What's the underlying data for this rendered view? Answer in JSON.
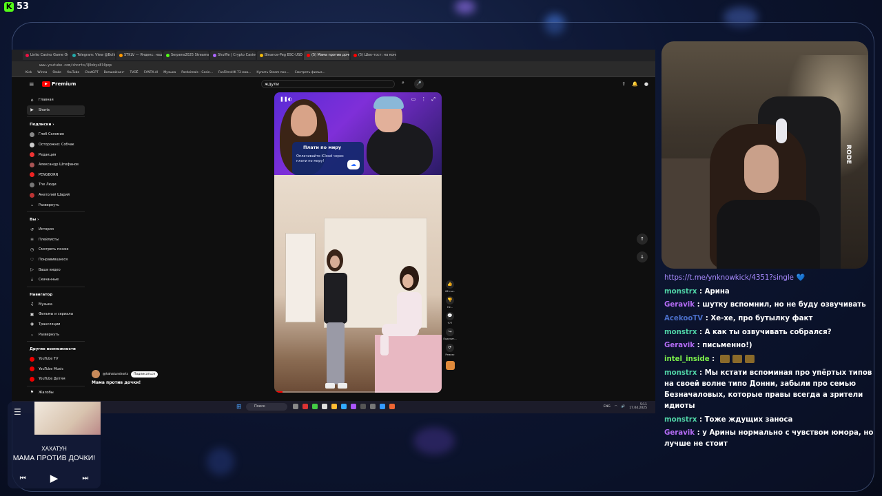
{
  "kick": {
    "viewer_count": "53"
  },
  "browser": {
    "tabs": [
      {
        "label": "Linko Casino Game Onlin",
        "color": "#e14"
      },
      {
        "label": "Telegram: View @Bollon",
        "color": "#2aa"
      },
      {
        "label": "STKLV — Яндекс: нашл",
        "color": "#f90"
      },
      {
        "label": "Serpens2025 Streams - kl",
        "color": "#53fc18"
      },
      {
        "label": "Shuffle | Crypto Casino S",
        "color": "#a6f"
      },
      {
        "label": "Binance-Peg BSC-USD (",
        "color": "#f0b90b"
      },
      {
        "label": "(5) Мама против доче",
        "color": "#f00"
      },
      {
        "label": "(5) Шок-тост: на концерт",
        "color": "#f00"
      }
    ],
    "url": "www.youtube.com/shorts/QOnbys8l0pqs",
    "bookmarks": [
      "Kick",
      "Winna",
      "Stake",
      "YouTube",
      "ChatGPT",
      "Вопшейнинг",
      "TVOЁ",
      "SYNTX.AI",
      "Музыка",
      "Pardaimals - Casin...",
      "FanFilmsHK 73 мов...",
      "Купить Steam пон...",
      "Смотреть фильм..."
    ]
  },
  "youtube": {
    "logo_text": "Premium",
    "search_value": "ждули",
    "sidebar": {
      "main": [
        {
          "label": "Главная",
          "icon": "home-icon",
          "glyph": "⌂"
        },
        {
          "label": "Shorts",
          "icon": "shorts-icon",
          "glyph": "▶",
          "active": true
        }
      ],
      "subs_heading": "Подписки  ›",
      "subs": [
        {
          "label": "Глеб Соломин",
          "color": "#888"
        },
        {
          "label": "Осторожно: Собчак",
          "color": "#ccc"
        },
        {
          "label": "Редакция",
          "color": "#e33"
        },
        {
          "label": "Александр Штефанов",
          "color": "#a55"
        },
        {
          "label": "PENGBORN",
          "color": "#e22"
        },
        {
          "label": "The Люди",
          "color": "#777"
        },
        {
          "label": "Анатолий Шарий",
          "color": "#b33"
        },
        {
          "label": "Развернуть",
          "color": "",
          "glyph": "⌄"
        }
      ],
      "you_heading": "Вы  ›",
      "you": [
        {
          "label": "История",
          "glyph": "↺"
        },
        {
          "label": "Плейлисты",
          "glyph": "≡"
        },
        {
          "label": "Смотреть позже",
          "glyph": "◷"
        },
        {
          "label": "Понравившиеся",
          "glyph": "♡"
        },
        {
          "label": "Ваши видео",
          "glyph": "▷"
        },
        {
          "label": "Скачанные",
          "glyph": "⤓"
        }
      ],
      "nav_heading": "Навигатор",
      "nav": [
        {
          "label": "Музыка",
          "glyph": "♫"
        },
        {
          "label": "Фильмы и сериалы",
          "glyph": "▣"
        },
        {
          "label": "Трансляции",
          "glyph": "◉"
        },
        {
          "label": "Развернуть",
          "glyph": "⌄"
        }
      ],
      "other_heading": "Другие возможности",
      "other": [
        {
          "label": "YouTube TV",
          "color": "#e00"
        },
        {
          "label": "YouTube Music",
          "color": "#e00"
        },
        {
          "label": "YouTube Детям",
          "color": "#e00"
        }
      ],
      "footer": "Жалобы"
    },
    "ad": {
      "title": "Плати по миру",
      "text": "Оплачивайте iCloud через плати по миру!"
    },
    "actions": [
      {
        "glyph": "👍",
        "label": "86 тыс."
      },
      {
        "glyph": "👎",
        "label": "Не..."
      },
      {
        "glyph": "💬",
        "label": "977"
      },
      {
        "glyph": "↪",
        "label": "Поделит..."
      },
      {
        "glyph": "⟳",
        "label": "Ремикс"
      }
    ],
    "channel_name": "@hahatunshorts",
    "subscribe_label": "Подписаться",
    "short_title": "Мама против дочки!",
    "progress": 0.05
  },
  "taskbar": {
    "search_placeholder": "Поиск",
    "lang": "ENG",
    "time": "5:11",
    "date": "17.04.2025"
  },
  "chat": {
    "link": "https://t.me/ynknowkick/4351?single",
    "messages": [
      {
        "user": "monstrx",
        "color": "#4fd1a5",
        "text": "Арина"
      },
      {
        "user": "Geravik",
        "color": "#b46cf5",
        "text": "шутку вспомнил, но не буду озвучивать"
      },
      {
        "user": "AcekooTV",
        "color": "#4a6ec8",
        "text": "Хе-хе, про бутылку факт"
      },
      {
        "user": "monstrx",
        "color": "#4fd1a5",
        "text": "А как ты озвучивать собрался?"
      },
      {
        "user": "Geravik",
        "color": "#b46cf5",
        "text": "письменно!)"
      },
      {
        "user": "intel_inside",
        "color": "#7cf04a",
        "text": "",
        "emotes": 3
      },
      {
        "user": "monstrx",
        "color": "#4fd1a5",
        "text": "Мы кстати вспоминая про упёртых типов на своей волне типо Донни, забыли про семью Безначаловых, которые правы всегда а зрители идиоты"
      },
      {
        "user": "monstrx",
        "color": "#4fd1a5",
        "text": "Тоже ждущих заноса"
      },
      {
        "user": "Geravik",
        "color": "#b46cf5",
        "text": "у Арины нормально с чувством юмора, но лучше не стоит"
      }
    ]
  },
  "player": {
    "artist": "ХАХАТУН",
    "title": "МАМА ПРОТИВ ДОЧКИ!"
  }
}
